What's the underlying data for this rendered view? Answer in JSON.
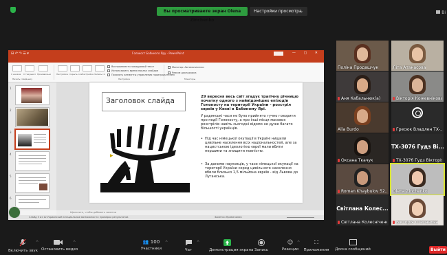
{
  "topbar": {
    "share_banner": "Вы просматриваете экран Olena Zinchenko",
    "view_options": "Настройки просмотра",
    "corner_label": "Ві"
  },
  "powerpoint": {
    "quick_access": "⊟ ↶ ↷ ☰ ▾",
    "doc_title": "Голокост Бабиного Яру - PowerPoint",
    "window_controls": "— ▢ ✕",
    "tabs": [
      "Файл",
      "Главная",
      "Вставка",
      "Конструктор",
      "Переходы",
      "Анимация",
      "Слайд-шоу",
      "Запись",
      "Рецензирование",
      "Вид",
      "Справка",
      "Load Testing",
      "Team",
      "Что вы хотите сделать?"
    ],
    "active_tab": "Слайд-шоу",
    "ribbon_groups": [
      "Начать слайд-шоу",
      "Настройка",
      "Мониторы"
    ],
    "ribbon_buttons": [
      "С начала",
      "С текущего слайда",
      "Произвольное слайд-шоу",
      "Настройка слайд-шоу",
      "Скрыть слайд",
      "Настройка времени",
      "Запись слайд-шоу"
    ],
    "checkboxes": [
      "Воспроизвести закадровый текст",
      "Использовать время показа слайдов",
      "Показать элементы управления проигрывателем"
    ],
    "monitor_label": "Монитор: Автоматически",
    "presenter_label": "Режим докладчика",
    "notes_placeholder": "Щелкните, чтобы добавить заметки",
    "status_left": "Слайд 3 из 12   Украинский   Специальные возможности: проверка результатов",
    "status_right": "Заметки   Примечания"
  },
  "slide": {
    "title": "Заголовок слайда",
    "heading": "29 вересня весь світ згадує трагічну річницю початку одного з найвідоміших епізодів Голокосту на території України - розстріл євреїв у Києві в Бабиному Ярі.",
    "paragraph": "У радянські часи не було прийнято гучно говорити про події Голокосту, а про інші місця масових розстрілів навіть сьогодні відомо не дуже багато більшості українців.",
    "bullets": [
      "Під час німецької окупації в Україні нищили цивільне населення всіх національностей, але за нацистською ідеологією євреї мали вбити першими та знищити повністю.",
      "За даними науковців, у часи німецької окупації на території України серед цивільного населення вбили близько 1,5 мільйона євреїв - від Львова до Луганська."
    ]
  },
  "participants": [
    {
      "name": "Поліна Продашчук",
      "big": "",
      "muted": false
    },
    {
      "name": "Літа Атанасова",
      "big": "",
      "muted": false
    },
    {
      "name": "Аня Кабальнюк(а)",
      "big": "",
      "muted": true
    },
    {
      "name": "Вікторія Кожевнікова",
      "big": "",
      "muted": true
    },
    {
      "name": "Alla Burdo",
      "big": "",
      "muted": false
    },
    {
      "name": "Гресюк Владлен ТХ-...",
      "big": "",
      "muted": true
    },
    {
      "name": "Оксана Ткачук",
      "big": "",
      "muted": true
    },
    {
      "name": "ТХ-3076 Гудз Вікторія",
      "big": "ТХ-3076 Гудз Ві...",
      "muted": true
    },
    {
      "name": "Roman Khaybulov 52...",
      "big": "",
      "muted": true
    },
    {
      "name": "Olena Zinchenko",
      "big": "",
      "muted": false
    },
    {
      "name": "Світлана Колесніченко",
      "big": "Світлана Колес...",
      "muted": true
    },
    {
      "name": "Вікторія Степанова",
      "big": "",
      "muted": true
    }
  ],
  "toolbar": {
    "mic": "Включить звук",
    "video": "Остановить видео",
    "participants": "Участники",
    "participants_count": "100",
    "chat": "Чат",
    "share": "Демонстрация экрана",
    "record": "Запись",
    "reactions": "Реакции",
    "apps": "Приложения",
    "whiteboard": "Доска сообщений",
    "leave": "Выйти"
  },
  "colors": {
    "share_green": "#2e9c3f",
    "powerpoint_red": "#c43e1c",
    "speaking_highlight": "#d7e32f",
    "leave_red": "#e02828"
  }
}
